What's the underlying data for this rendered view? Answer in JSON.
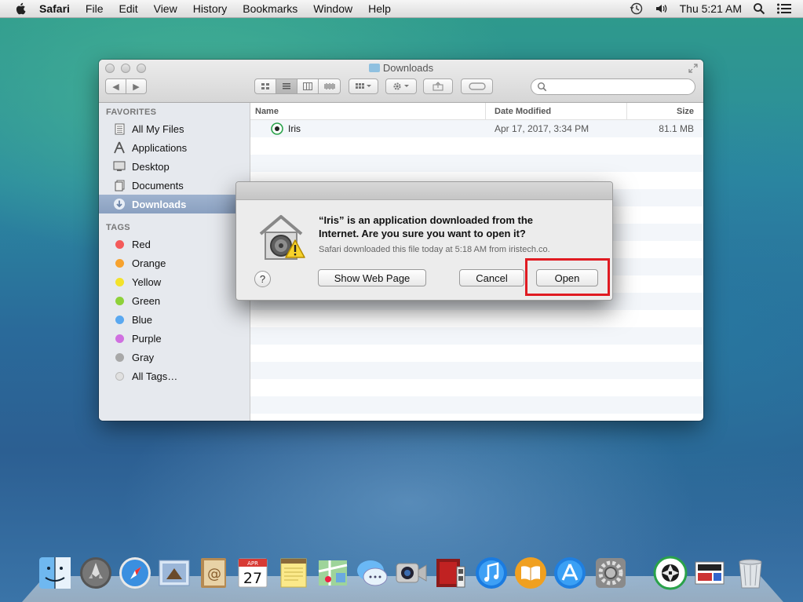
{
  "menubar": {
    "app_name": "Safari",
    "menus": [
      "File",
      "Edit",
      "View",
      "History",
      "Bookmarks",
      "Window",
      "Help"
    ],
    "clock": "Thu 5:21 AM",
    "status_icons": [
      "time-machine-icon",
      "volume-icon",
      "spotlight-icon",
      "notification-center-icon"
    ]
  },
  "finder": {
    "title": "Downloads",
    "sidebar": {
      "favorites_header": "FAVORITES",
      "favorites": [
        {
          "label": "All My Files",
          "icon": "all-files-icon"
        },
        {
          "label": "Applications",
          "icon": "applications-icon"
        },
        {
          "label": "Desktop",
          "icon": "desktop-icon"
        },
        {
          "label": "Documents",
          "icon": "documents-icon"
        },
        {
          "label": "Downloads",
          "icon": "downloads-icon",
          "selected": true
        }
      ],
      "tags_header": "TAGS",
      "tags": [
        {
          "label": "Red",
          "color": "#f45a5a"
        },
        {
          "label": "Orange",
          "color": "#f7a22e"
        },
        {
          "label": "Yellow",
          "color": "#f3e22b"
        },
        {
          "label": "Green",
          "color": "#8ed13a"
        },
        {
          "label": "Blue",
          "color": "#5aa8f0"
        },
        {
          "label": "Purple",
          "color": "#d070e0"
        },
        {
          "label": "Gray",
          "color": "#a8a8a8"
        },
        {
          "label": "All Tags…",
          "color": "#e0e0e0"
        }
      ]
    },
    "columns": {
      "name": "Name",
      "date": "Date Modified",
      "size": "Size"
    },
    "files": [
      {
        "name": "Iris",
        "date": "Apr 17, 2017, 3:34 PM",
        "size": "81.1 MB"
      }
    ]
  },
  "dialog": {
    "message_line1": "“Iris” is an application downloaded from the",
    "message_line2": "Internet. Are you sure you want to open it?",
    "detail": "Safari downloaded this file today at 5:18 AM from iristech.co.",
    "help_label": "?",
    "show_web_page_label": "Show Web Page",
    "cancel_label": "Cancel",
    "open_label": "Open",
    "highlight_color": "#e01b22"
  },
  "dock": {
    "icons": [
      "finder-icon",
      "launchpad-icon",
      "safari-icon",
      "mail-icon",
      "contacts-icon",
      "calendar-icon",
      "notes-icon",
      "maps-icon",
      "messages-icon",
      "facetime-icon",
      "photo-booth-icon",
      "itunes-icon",
      "ibooks-icon",
      "app-store-icon",
      "system-preferences-icon",
      "iris-icon",
      "preview-icon",
      "trash-icon"
    ],
    "calendar_month": "APR",
    "calendar_day": "27"
  }
}
